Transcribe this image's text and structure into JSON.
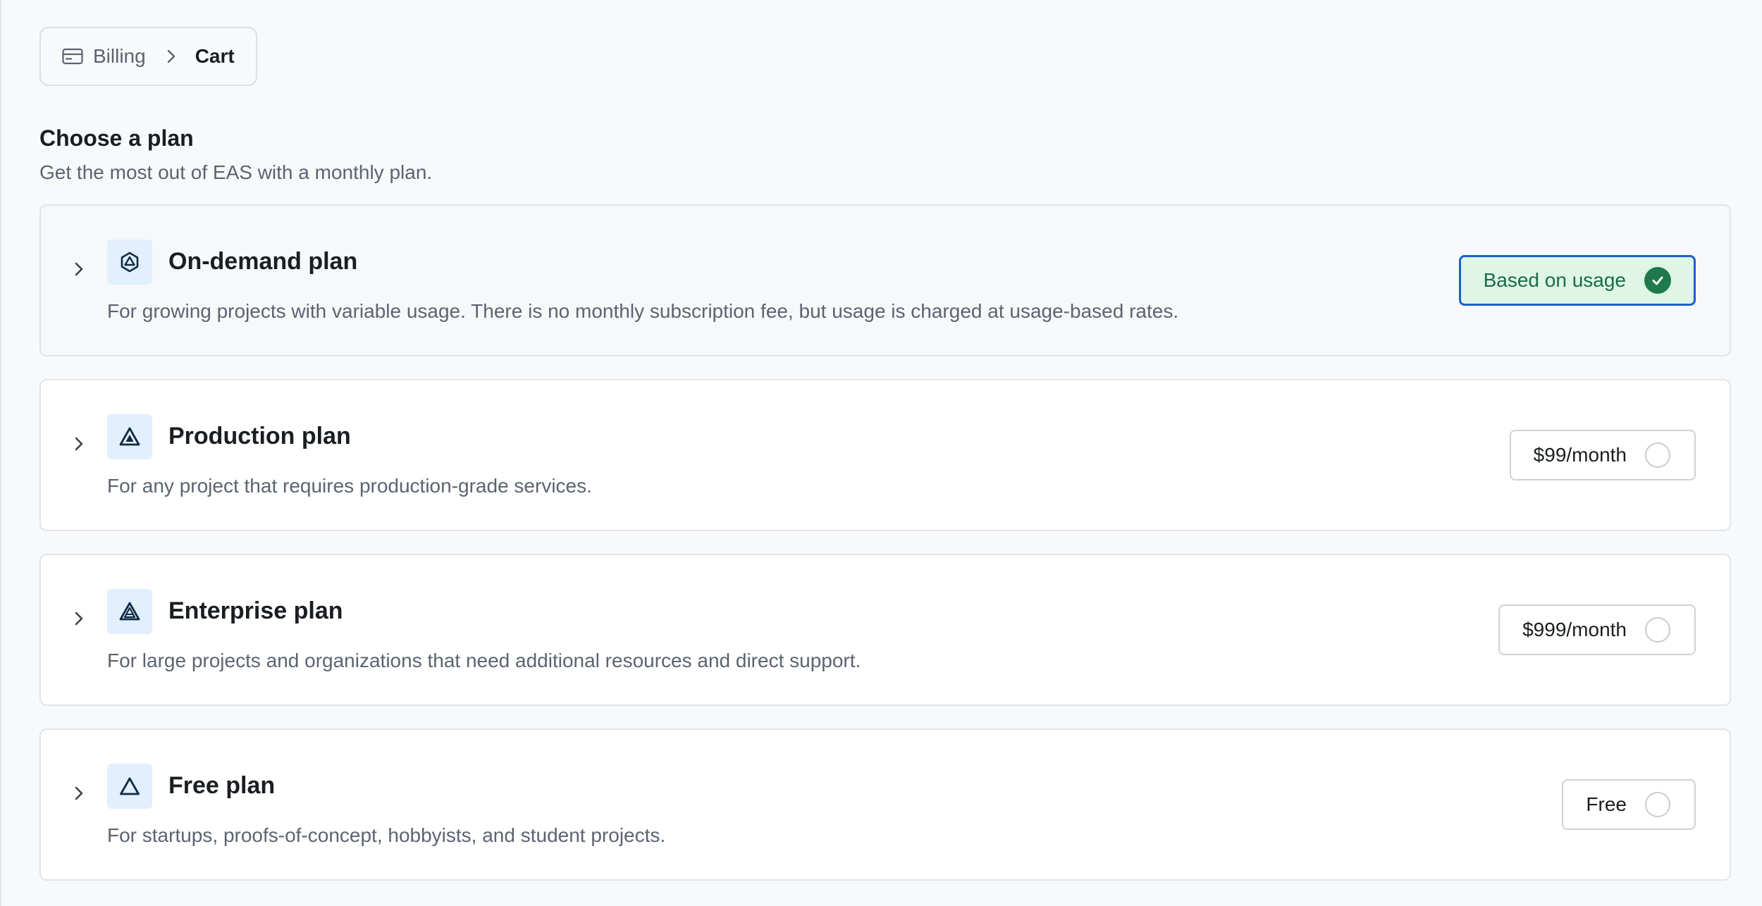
{
  "breadcrumb": {
    "icon": "credit-card-icon",
    "billing_label": "Billing",
    "separator_icon": "chevron-right-icon",
    "current_label": "Cart"
  },
  "header": {
    "title": "Choose a plan",
    "subtitle": "Get the most out of EAS with a monthly plan."
  },
  "plans": [
    {
      "name": "On-demand plan",
      "description": "For growing projects with variable usage. There is no monthly subscription fee, but usage is charged at usage-based rates.",
      "price_label": "Based on usage",
      "selected": true,
      "icon": "hexagon-logo-icon"
    },
    {
      "name": "Production plan",
      "description": "For any project that requires production-grade services.",
      "price_label": "$99/month",
      "selected": false,
      "icon": "triangle-logo-icon"
    },
    {
      "name": "Enterprise plan",
      "description": "For large projects and organizations that need additional resources and direct support.",
      "price_label": "$999/month",
      "selected": false,
      "icon": "triangle-logo-icon"
    },
    {
      "name": "Free plan",
      "description": "For startups, proofs-of-concept, hobbyists, and student projects.",
      "price_label": "Free",
      "selected": false,
      "icon": "triangle-outline-icon"
    }
  ],
  "colors": {
    "selected_bg": "#dff5e6",
    "selected_border": "#1962c9",
    "selected_text": "#1b6b45",
    "check_fill": "#1e7a4c",
    "icon_tile_bg": "#e1efff"
  }
}
